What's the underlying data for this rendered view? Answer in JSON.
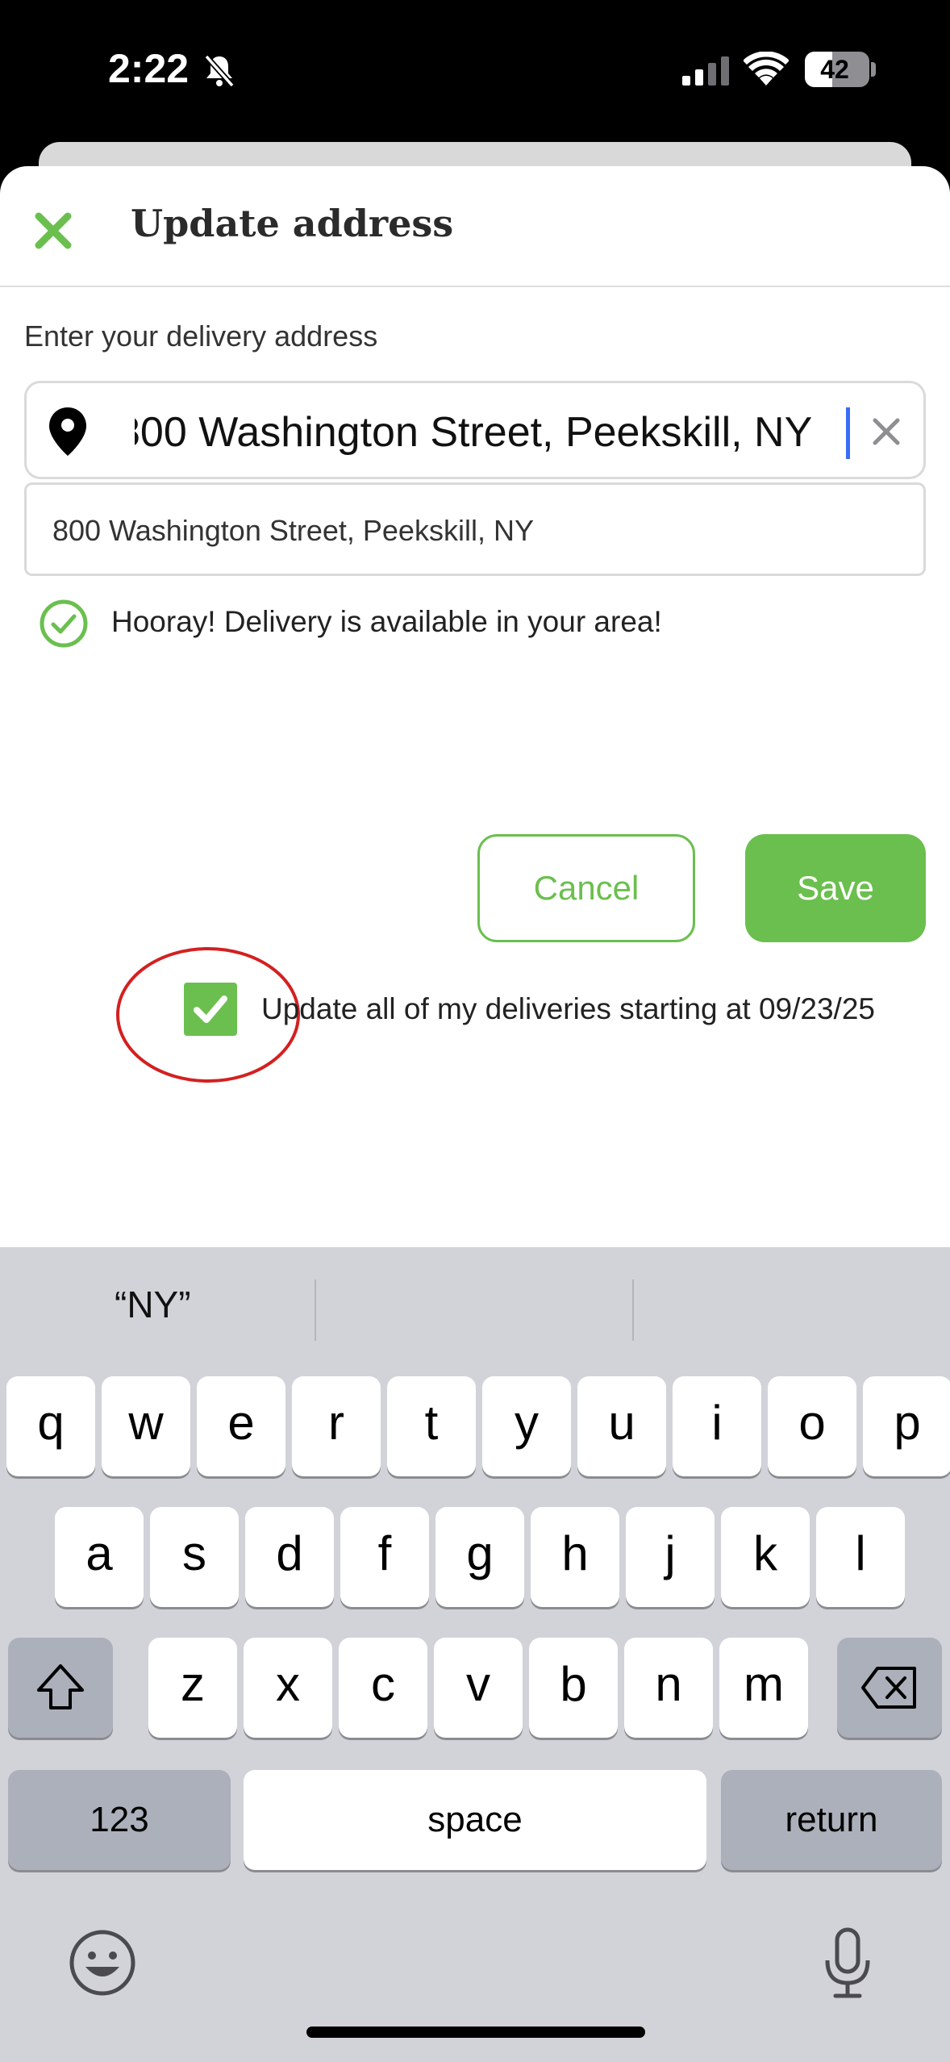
{
  "status_bar": {
    "time": "2:22",
    "battery_level": "42",
    "battery_fraction": 0.42
  },
  "header": {
    "title": "Update address"
  },
  "form": {
    "prompt": "Enter your delivery address",
    "address_value": "800 Washington Street, Peekskill, NY",
    "suggestion": "800 Washington Street, Peekskill, NY",
    "availability_message": "Hooray! Delivery is available in your area!"
  },
  "actions": {
    "cancel_label": "Cancel",
    "save_label": "Save"
  },
  "update_all": {
    "checked": true,
    "label": "Update all of my deliveries starting at 09/23/25"
  },
  "keyboard": {
    "prediction": "“NY”",
    "row1": [
      "q",
      "w",
      "e",
      "r",
      "t",
      "y",
      "u",
      "i",
      "o",
      "p"
    ],
    "row2": [
      "a",
      "s",
      "d",
      "f",
      "g",
      "h",
      "j",
      "k",
      "l"
    ],
    "row3": [
      "z",
      "x",
      "c",
      "v",
      "b",
      "n",
      "m"
    ],
    "numbers_label": "123",
    "space_label": "space",
    "return_label": "return"
  },
  "colors": {
    "accent": "#6bbf4e",
    "caret": "#3b6cf6",
    "annotation": "#d42020"
  }
}
